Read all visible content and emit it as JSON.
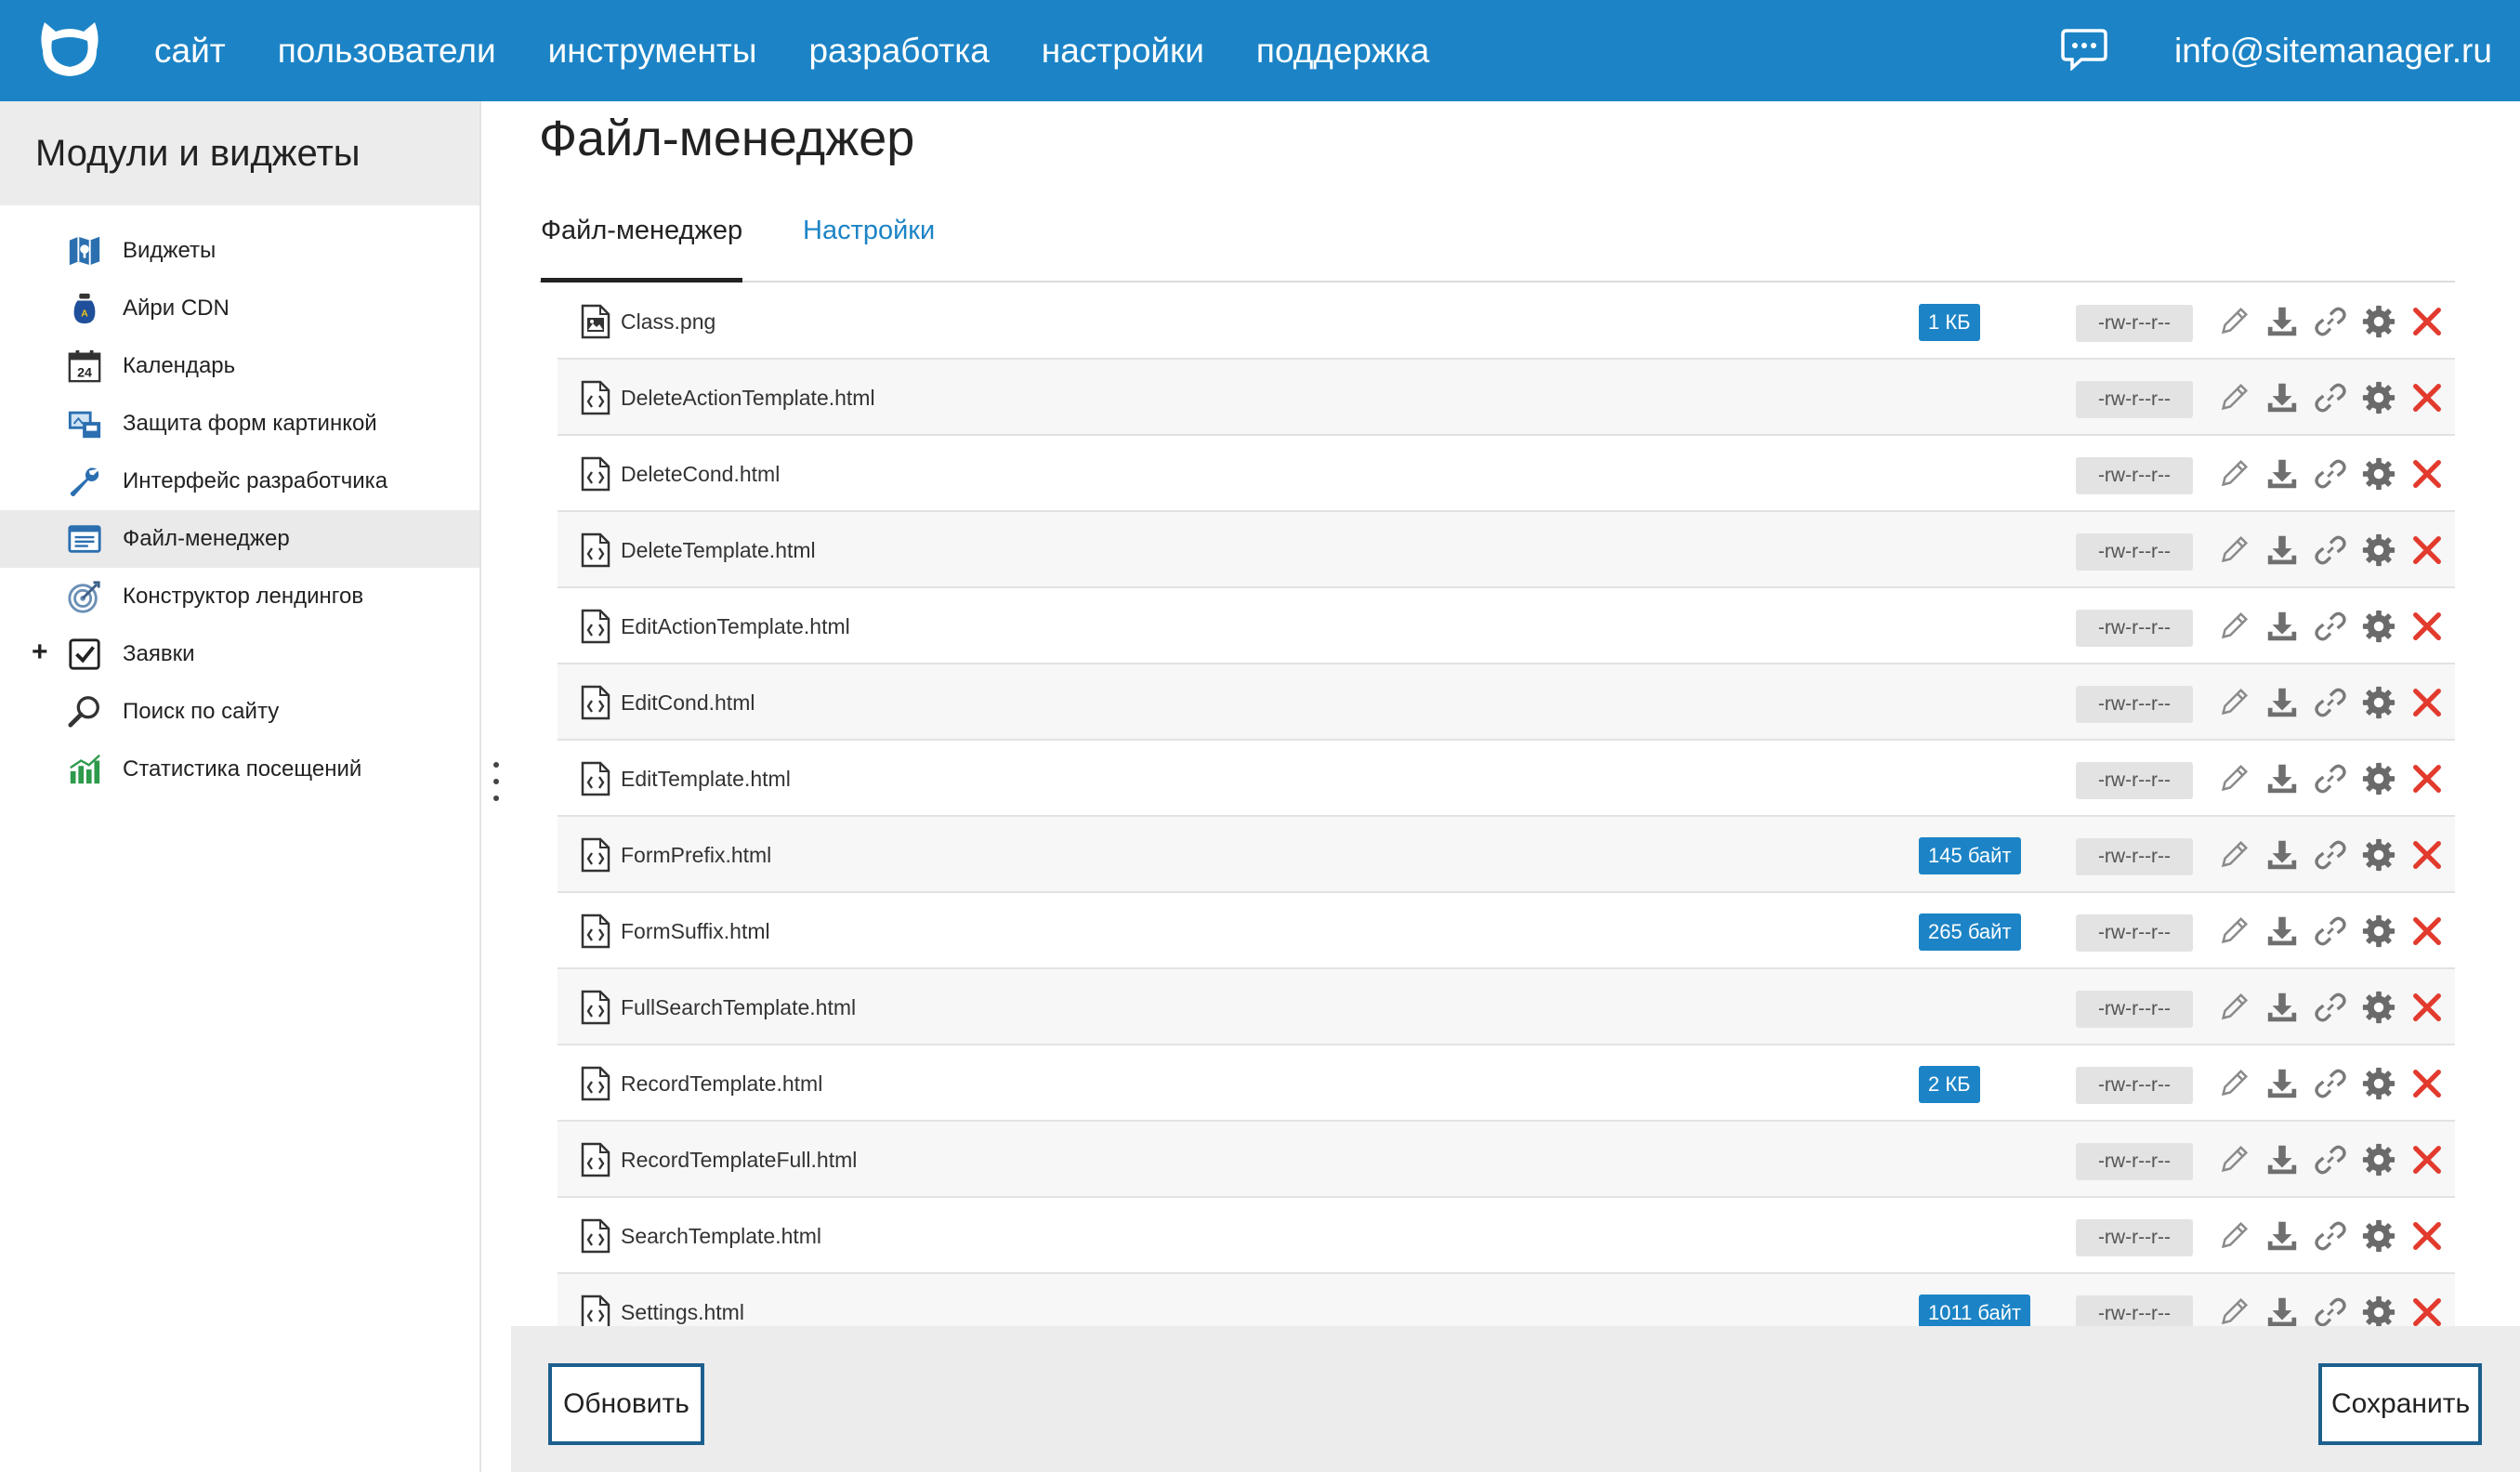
{
  "topbar": {
    "nav": [
      "сайт",
      "пользователи",
      "инструменты",
      "разработка",
      "настройки",
      "поддержка"
    ],
    "user_email": "info@sitemanager.ru",
    "colors": {
      "brand": "#1c84c6"
    }
  },
  "sidebar": {
    "title": "Модули и виджеты",
    "active_index": 5,
    "items": [
      {
        "label": "Виджеты",
        "icon": "widgets-map-icon"
      },
      {
        "label": "Айри CDN",
        "icon": "cdn-bottle-icon"
      },
      {
        "label": "Календарь",
        "icon": "calendar-icon",
        "icon_text": "24"
      },
      {
        "label": "Защита форм картинкой",
        "icon": "captcha-icon"
      },
      {
        "label": "Интерфейс разработчика",
        "icon": "wrench-icon"
      },
      {
        "label": "Файл-менеджер",
        "icon": "file-manager-icon"
      },
      {
        "label": "Конструктор лендингов",
        "icon": "target-icon"
      },
      {
        "label": "Заявки",
        "icon": "checkbox-icon",
        "expand": "+"
      },
      {
        "label": "Поиск по сайту",
        "icon": "magnifier-icon"
      },
      {
        "label": "Статистика посещений",
        "icon": "stats-bars-icon"
      }
    ]
  },
  "main": {
    "title": "Файл-менеджер",
    "tabs": [
      {
        "label": "Файл-менеджер",
        "active": true
      },
      {
        "label": "Настройки",
        "active": false
      }
    ],
    "files": [
      {
        "name": "Class.png",
        "type": "image",
        "size": "1 КБ",
        "perms": "-rw-r--r--"
      },
      {
        "name": "DeleteActionTemplate.html",
        "type": "code",
        "size": "",
        "perms": "-rw-r--r--"
      },
      {
        "name": "DeleteCond.html",
        "type": "code",
        "size": "",
        "perms": "-rw-r--r--"
      },
      {
        "name": "DeleteTemplate.html",
        "type": "code",
        "size": "",
        "perms": "-rw-r--r--"
      },
      {
        "name": "EditActionTemplate.html",
        "type": "code",
        "size": "",
        "perms": "-rw-r--r--"
      },
      {
        "name": "EditCond.html",
        "type": "code",
        "size": "",
        "perms": "-rw-r--r--"
      },
      {
        "name": "EditTemplate.html",
        "type": "code",
        "size": "",
        "perms": "-rw-r--r--"
      },
      {
        "name": "FormPrefix.html",
        "type": "code",
        "size": "145 байт",
        "perms": "-rw-r--r--"
      },
      {
        "name": "FormSuffix.html",
        "type": "code",
        "size": "265 байт",
        "perms": "-rw-r--r--"
      },
      {
        "name": "FullSearchTemplate.html",
        "type": "code",
        "size": "",
        "perms": "-rw-r--r--"
      },
      {
        "name": "RecordTemplate.html",
        "type": "code",
        "size": "2 КБ",
        "perms": "-rw-r--r--"
      },
      {
        "name": "RecordTemplateFull.html",
        "type": "code",
        "size": "",
        "perms": "-rw-r--r--"
      },
      {
        "name": "SearchTemplate.html",
        "type": "code",
        "size": "",
        "perms": "-rw-r--r--"
      },
      {
        "name": "Settings.html",
        "type": "code",
        "size": "1011 байт",
        "perms": "-rw-r--r--"
      }
    ],
    "row_actions": [
      "pencil-icon",
      "download-icon",
      "link-icon",
      "gear-icon",
      "delete-x-icon"
    ]
  },
  "footer": {
    "refresh_label": "Обновить",
    "save_label": "Сохранить"
  }
}
